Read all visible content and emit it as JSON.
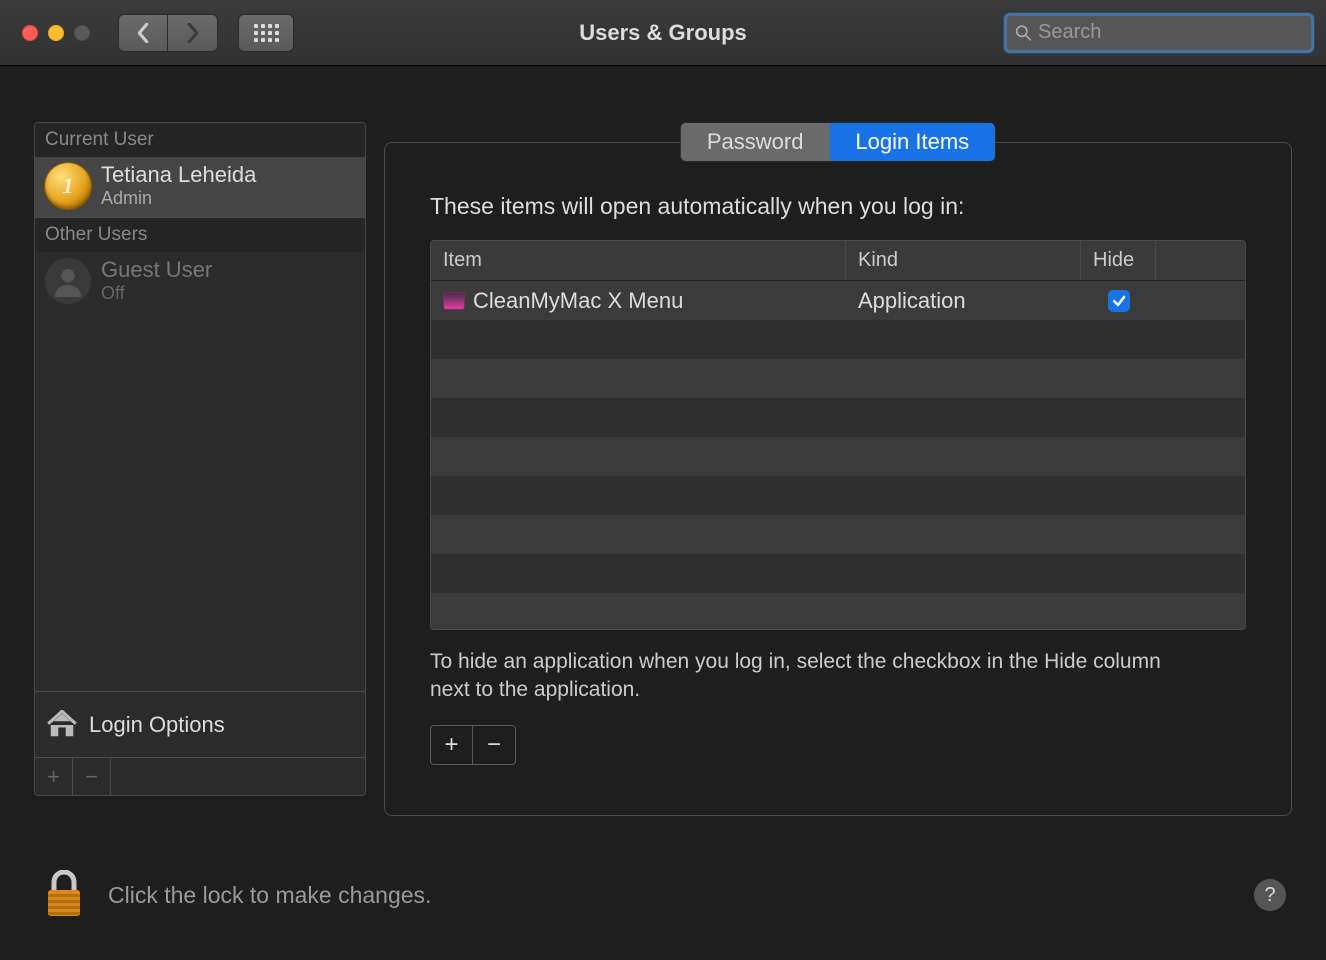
{
  "window": {
    "title": "Users & Groups",
    "search_placeholder": "Search"
  },
  "sidebar": {
    "current_header": "Current User",
    "other_header": "Other Users",
    "login_options": "Login Options",
    "current_user": {
      "name": "Tetiana Leheida",
      "role": "Admin"
    },
    "guest_user": {
      "name": "Guest User",
      "role": "Off"
    }
  },
  "tabs": {
    "password": "Password",
    "login_items": "Login Items"
  },
  "main": {
    "heading": "These items will open automatically when you log in:",
    "columns": {
      "item": "Item",
      "kind": "Kind",
      "hide": "Hide"
    },
    "rows": [
      {
        "name": "CleanMyMac X Menu",
        "kind": "Application",
        "hide": true
      }
    ],
    "hint": "To hide an application when you log in, select the checkbox in the Hide column next to the application."
  },
  "footer": {
    "lock_text": "Click the lock to make changes.",
    "help": "?"
  },
  "glyphs": {
    "plus": "+",
    "minus": "−",
    "medal": "1"
  }
}
